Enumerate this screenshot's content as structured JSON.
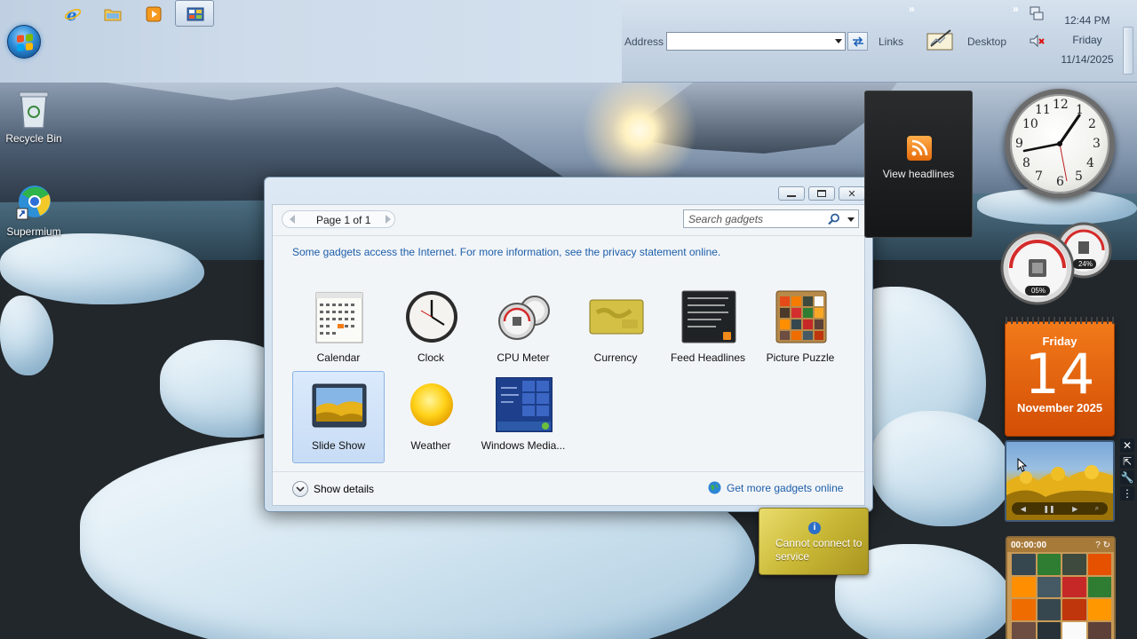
{
  "taskbar": {
    "address_label": "Address",
    "address_value": "",
    "links_label": "Links",
    "desktop_label": "Desktop",
    "overflow_glyph": "»",
    "clock": {
      "time": "12:44 PM",
      "day": "Friday",
      "date": "11/14/2025"
    }
  },
  "desktop_icons": [
    {
      "label": "Recycle Bin",
      "icon": "recycle-bin-icon"
    },
    {
      "label": "Supermium",
      "icon": "supermium-icon"
    }
  ],
  "gallery": {
    "pager": "Page 1 of 1",
    "search_placeholder": "Search gadgets",
    "info_text": "Some gadgets access the Internet.  For more information, see the privacy statement online.",
    "gadgets": [
      {
        "label": "Calendar",
        "icon": "calendar-icon"
      },
      {
        "label": "Clock",
        "icon": "clock-icon"
      },
      {
        "label": "CPU Meter",
        "icon": "cpu-meter-icon"
      },
      {
        "label": "Currency",
        "icon": "currency-icon"
      },
      {
        "label": "Feed Headlines",
        "icon": "feed-headlines-icon"
      },
      {
        "label": "Picture Puzzle",
        "icon": "picture-puzzle-icon"
      },
      {
        "label": "Slide Show",
        "icon": "slide-show-icon",
        "selected": true
      },
      {
        "label": "Weather",
        "icon": "weather-icon"
      },
      {
        "label": "Windows Media...",
        "icon": "windows-media-icon"
      }
    ],
    "show_details": "Show details",
    "get_more": "Get more gadgets online"
  },
  "side_gadgets": {
    "feed": {
      "label": "View headlines"
    },
    "cpu": {
      "cpu_percent": "05%",
      "memory_percent": "24%"
    },
    "calendar": {
      "weekday": "Friday",
      "day": "14",
      "month_year": "November 2025"
    },
    "currency": {
      "message": "Cannot connect to service"
    },
    "puzzle": {
      "timer": "00:00:00"
    }
  },
  "colors": {
    "accent": "#1d5ea9",
    "calendar": "#e8650f",
    "selection": "#c7dcf5"
  }
}
